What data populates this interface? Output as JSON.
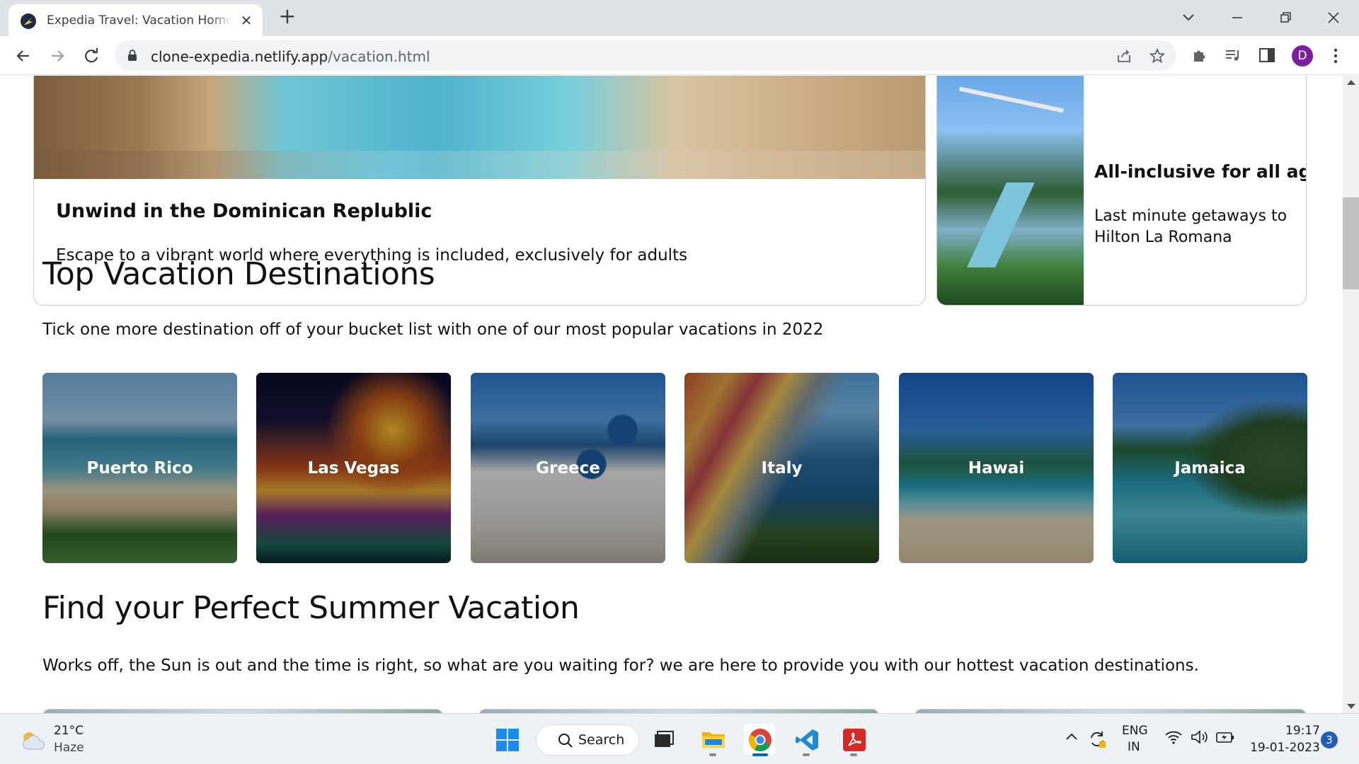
{
  "browser": {
    "tab_title": "Expedia Travel: Vacation Homes, Hotels, Car Rentals",
    "url_host": "clone-expedia.netlify.app",
    "url_path": "/vacation.html",
    "profile_initial": "D"
  },
  "page": {
    "feature_big": {
      "title": "Unwind in the Dominican Replublic",
      "text": "Escape to a vibrant world where everything is included, exclusively for adults"
    },
    "feature_small": {
      "title": "All-inclusive for all ages",
      "text": "Last minute getaways to Hilton La Romana"
    },
    "top_destinations": {
      "title": "Top Vacation Destinations",
      "text": "Tick one more destination off of your bucket list with one of our most popular vacations in 2022",
      "items": [
        {
          "label": "Puerto Rico"
        },
        {
          "label": "Las Vegas"
        },
        {
          "label": "Greece"
        },
        {
          "label": "Italy"
        },
        {
          "label": "Hawai"
        },
        {
          "label": "Jamaica"
        }
      ]
    },
    "summer": {
      "title": "Find your Perfect Summer Vacation",
      "text": "Works off, the Sun is out and the time is right, so what are you waiting for? we are here to provide you with our hottest vacation destinations."
    }
  },
  "taskbar": {
    "weather_temp": "21°C",
    "weather_cond": "Haze",
    "search_label": "Search",
    "lang_line1": "ENG",
    "lang_line2": "IN",
    "time": "19:17",
    "date": "19-01-2023",
    "notification_count": "3"
  }
}
